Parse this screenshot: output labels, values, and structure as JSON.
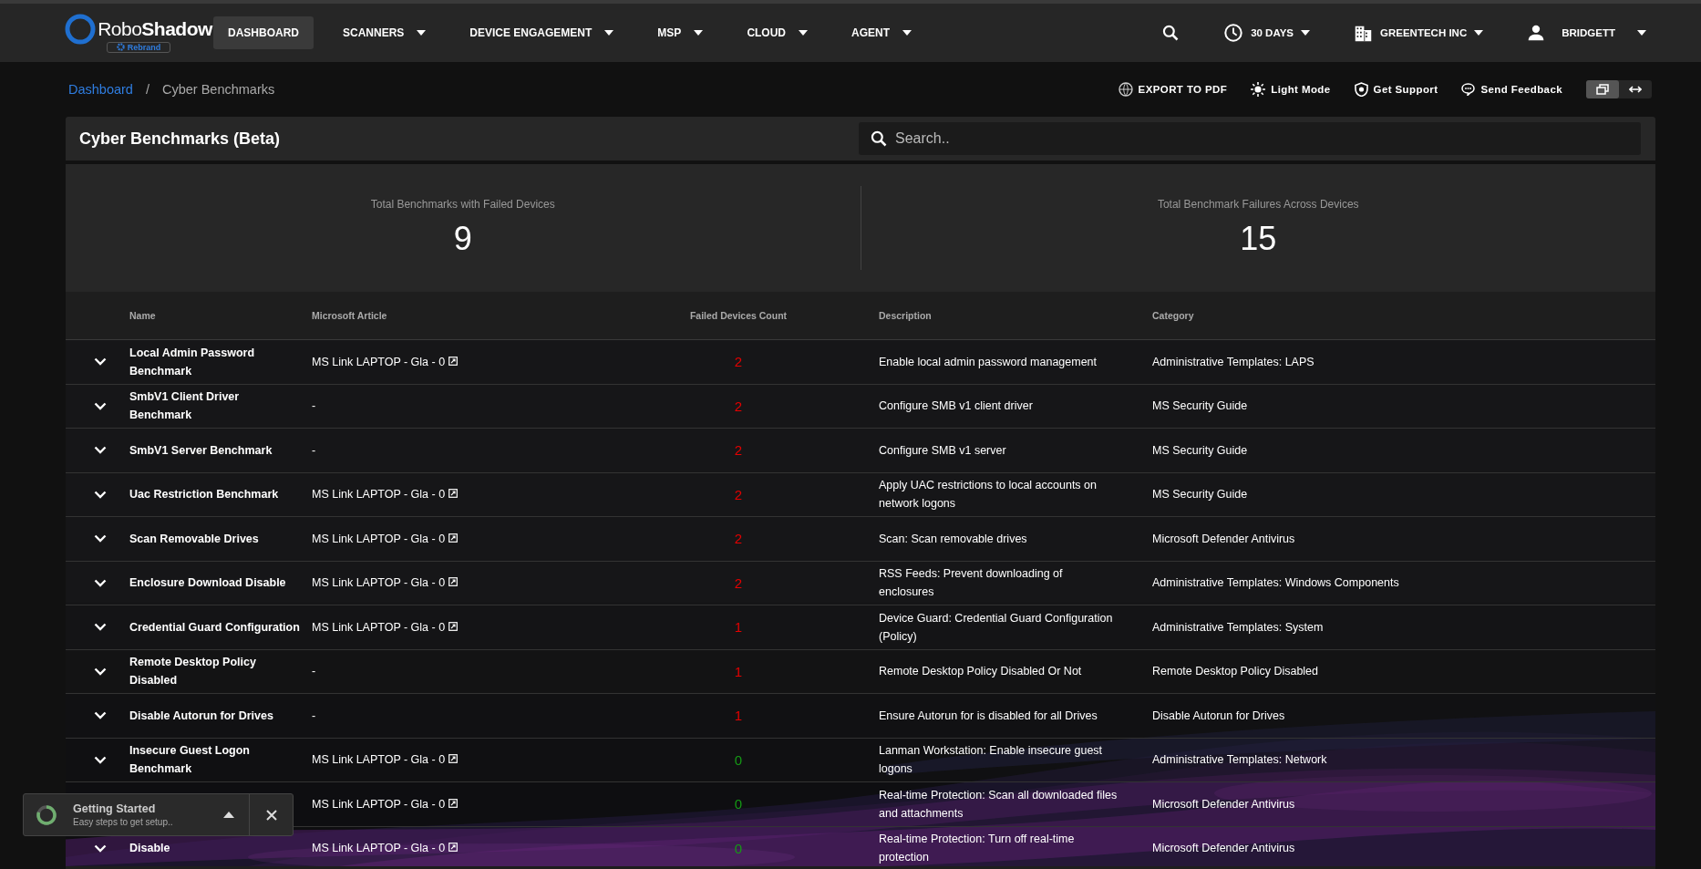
{
  "nav": {
    "logo": {
      "name": "Robo**Shadow**",
      "badge": "Rebrand"
    },
    "items": [
      {
        "label": "DASHBOARD",
        "selected": true,
        "dropdown": false
      },
      {
        "label": "SCANNERS",
        "selected": false,
        "dropdown": true
      },
      {
        "label": "DEVICE ENGAGEMENT",
        "selected": false,
        "dropdown": true
      },
      {
        "label": "MSP",
        "selected": false,
        "dropdown": true
      },
      {
        "label": "CLOUD",
        "selected": false,
        "dropdown": true
      },
      {
        "label": "AGENT",
        "selected": false,
        "dropdown": true
      }
    ],
    "period": "30 DAYS",
    "company": "GREENTECH INC",
    "user": "BRIDGETT"
  },
  "breadcrumb": {
    "items": [
      {
        "label": "Dashboard",
        "kind": "link"
      },
      {
        "label": "Cyber Benchmarks",
        "kind": "current"
      }
    ],
    "separator": "/"
  },
  "actions": [
    {
      "label": "EXPORT TO PDF",
      "kind": "export"
    },
    {
      "label": "Light Mode",
      "kind": "theme"
    },
    {
      "label": "Get  Support",
      "kind": "support"
    },
    {
      "label": "Send Feedback",
      "kind": "feedback"
    }
  ],
  "view_toggle": [
    {
      "kind": "windowed",
      "selected": true
    },
    {
      "kind": "wide",
      "selected": false
    }
  ],
  "panel": {
    "title": "Cyber Benchmarks (Beta)",
    "search": {
      "placeholder": "Search.."
    }
  },
  "stats": [
    {
      "label": "Total Benchmarks with Failed Devices",
      "value": "9"
    },
    {
      "label": "Total Benchmark Failures Across Devices",
      "value": "15"
    }
  ],
  "table": {
    "columns": [
      "Name",
      "Microsoft Article",
      "Failed Devices Count",
      "Description",
      "Category"
    ],
    "rows": [
      {
        "name": "Local Admin Password Benchmark",
        "article": "MS Link LAPTOP - Gla - 0",
        "link": true,
        "count": "2",
        "color": "#e50000",
        "description": "Enable local admin password management",
        "category": "Administrative Templates: LAPS"
      },
      {
        "name": "SmbV1 Client Driver Benchmark",
        "article": "-",
        "link": false,
        "count": "2",
        "color": "#e50000",
        "description": "Configure SMB v1 client driver",
        "category": "MS Security Guide"
      },
      {
        "name": "SmbV1 Server Benchmark",
        "article": "-",
        "link": false,
        "count": "2",
        "color": "#e50000",
        "description": "Configure SMB v1 server",
        "category": "MS Security Guide"
      },
      {
        "name": "Uac Restriction Benchmark",
        "article": "MS Link LAPTOP - Gla - 0",
        "link": true,
        "count": "2",
        "color": "#e50000",
        "description": "Apply UAC restrictions to local accounts on network logons",
        "category": "MS Security Guide"
      },
      {
        "name": "Scan Removable Drives",
        "article": "MS Link LAPTOP - Gla - 0",
        "link": true,
        "count": "2",
        "color": "#e50000",
        "description": "Scan: Scan removable drives",
        "category": "Microsoft Defender Antivirus"
      },
      {
        "name": "Enclosure Download Disable",
        "article": "MS Link LAPTOP - Gla - 0",
        "link": true,
        "count": "2",
        "color": "#e50000",
        "description": "RSS Feeds: Prevent downloading of enclosures",
        "category": "Administrative Templates: Windows Components"
      },
      {
        "name": "Credential Guard Configuration",
        "article": "MS Link LAPTOP - Gla - 0",
        "link": true,
        "count": "1",
        "color": "#e50000",
        "description": "Device Guard: Credential Guard Configuration (Policy)",
        "category": "Administrative Templates: System"
      },
      {
        "name": "Remote Desktop Policy Disabled",
        "article": "-",
        "link": false,
        "count": "1",
        "color": "#e50000",
        "description": "Remote Desktop Policy Disabled Or Not",
        "category": "Remote Desktop Policy Disabled"
      },
      {
        "name": "Disable Autorun for Drives",
        "article": "-",
        "link": false,
        "count": "1",
        "color": "#e50000",
        "description": "Ensure Autorun for is disabled for all Drives",
        "category": "Disable Autorun for Drives"
      },
      {
        "name": "Insecure Guest Logon Benchmark",
        "article": "MS Link LAPTOP - Gla - 0",
        "link": true,
        "count": "0",
        "color": "#159a15",
        "description": "Lanman Workstation: Enable insecure guest logons",
        "category": "Administrative Templates: Network"
      },
      {
        "covered": true,
        "article": "MS Link LAPTOP - Gla - 0",
        "link": true,
        "count": "0",
        "color": "#159a15",
        "description": "Real-time Protection: Scan all downloaded files and attachments",
        "category": "Microsoft Defender Antivirus"
      },
      {
        "name": "Disable",
        "article": "MS Link LAPTOP - Gla - 0",
        "link": true,
        "count": "0",
        "color": "#159a15",
        "description": "Real-time Protection: Turn off real-time protection",
        "category": "Microsoft Defender Antivirus"
      }
    ]
  },
  "toast": {
    "title": "Getting Started",
    "subtitle": "Easy steps to get setup..",
    "level": 0.8
  }
}
